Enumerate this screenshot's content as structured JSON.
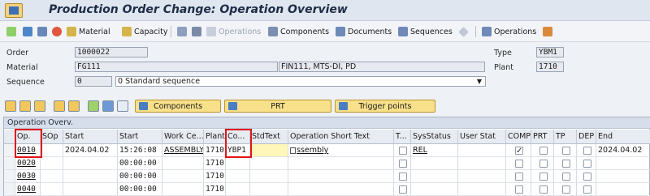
{
  "window": {
    "title": "Production Order Change: Operation Overview"
  },
  "toolbar": {
    "material": "Material",
    "capacity": "Capacity",
    "operations_disabled": "Operations",
    "components": "Components",
    "documents": "Documents",
    "sequences": "Sequences",
    "operations": "Operations"
  },
  "header": {
    "order_label": "Order",
    "order_value": "1000022",
    "type_label": "Type",
    "type_value": "YBM1",
    "material_label": "Material",
    "material_value": "FG111",
    "material_desc": "FIN111, MTS-DI, PD",
    "plant_label": "Plant",
    "plant_value": "1710",
    "sequence_label": "Sequence",
    "sequence_value": "0",
    "sequence_desc": "0 Standard sequence"
  },
  "buttons": {
    "components": "Components",
    "prt": "PRT",
    "trigger_points": "Trigger points"
  },
  "grid": {
    "title": "Operation Overv.",
    "columns": [
      "Op.",
      "SOp",
      "Start",
      "Start",
      "Work Ce...",
      "Plant",
      "Co...",
      "StdText",
      "Operation Short Text",
      "T...",
      "SysStatus",
      "User Stat",
      "COMP",
      "PRT",
      "TP",
      "DEP",
      "End"
    ],
    "rows": [
      {
        "op": "0010",
        "sop": "",
        "start_date": "2024.04.02",
        "start_time": "15:26:08",
        "work_center": "ASSEMBLY",
        "plant": "1710",
        "control_key": "YBP1",
        "std_text": "",
        "short_text": "ssembly",
        "sys_status": "REL",
        "user_stat": "",
        "comp": true,
        "end_date": "2024.04.02"
      },
      {
        "op": "0020",
        "sop": "",
        "start_date": "",
        "start_time": "00:00:00",
        "work_center": "",
        "plant": "1710",
        "control_key": "",
        "std_text": "",
        "short_text": "",
        "sys_status": "",
        "user_stat": "",
        "comp": false,
        "end_date": ""
      },
      {
        "op": "0030",
        "sop": "",
        "start_date": "",
        "start_time": "00:00:00",
        "work_center": "",
        "plant": "1710",
        "control_key": "",
        "std_text": "",
        "short_text": "",
        "sys_status": "",
        "user_stat": "",
        "comp": false,
        "end_date": ""
      },
      {
        "op": "0040",
        "sop": "",
        "start_date": "",
        "start_time": "00:00:00",
        "work_center": "",
        "plant": "1710",
        "control_key": "",
        "std_text": "",
        "short_text": "",
        "sys_status": "",
        "user_stat": "",
        "comp": false,
        "end_date": ""
      }
    ]
  }
}
